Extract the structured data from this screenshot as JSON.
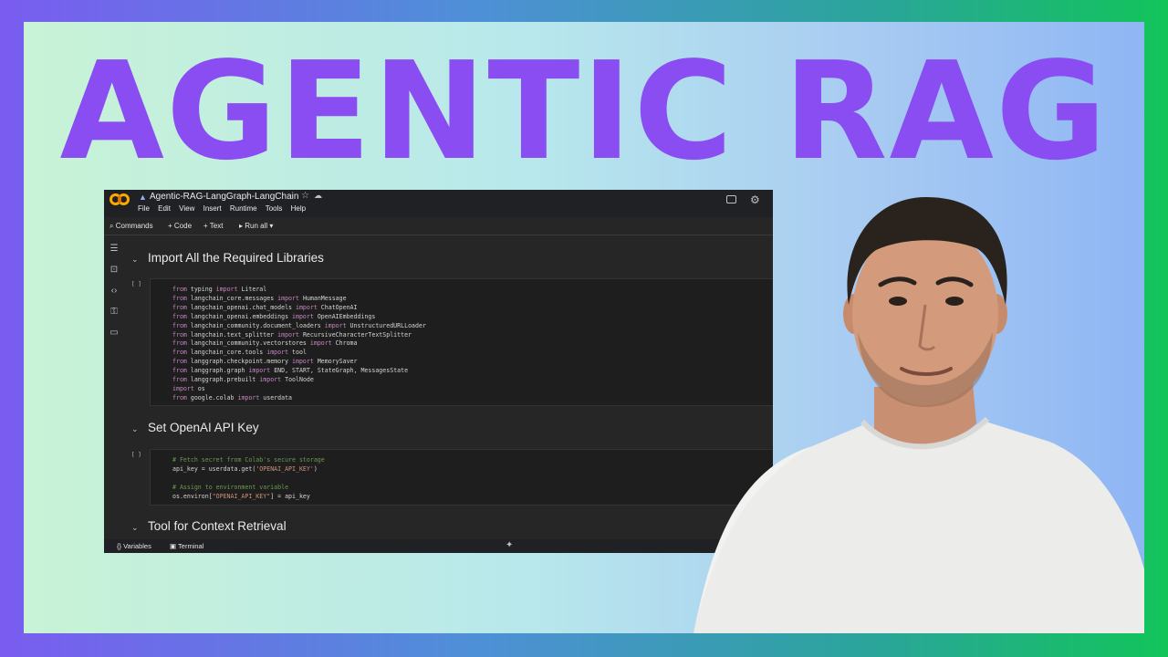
{
  "headline": "AGENTIC RAG",
  "colab": {
    "notebook_title": "Agentic-RAG-LangGraph-LangChain",
    "menu": [
      "File",
      "Edit",
      "View",
      "Insert",
      "Runtime",
      "Tools",
      "Help"
    ],
    "toolbar": {
      "commands": "Commands",
      "code": "+ Code",
      "text": "+ Text",
      "run_all": "Run all"
    },
    "sections": [
      "Import All the Required Libraries",
      "Set OpenAI API Key",
      "Tool for Context Retrieval"
    ],
    "cell_run_label": "[ ]",
    "statusbar": {
      "variables": "Variables",
      "terminal": "Terminal"
    }
  },
  "colors": {
    "headline": "#8a4df2",
    "colab_bg": "#262626",
    "code_bg": "#1e1e1e",
    "keyword": "#c586c0",
    "comment": "#6a9955",
    "string": "#ce9178"
  }
}
